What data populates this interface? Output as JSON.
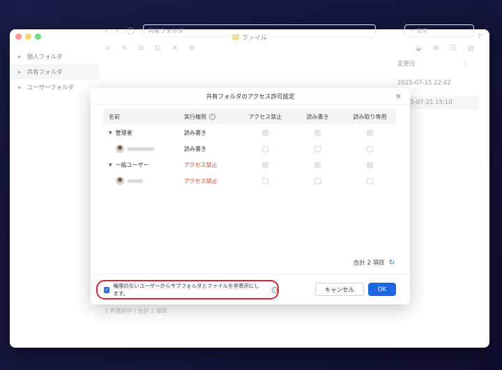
{
  "window": {
    "title": "ファイル",
    "help": "?"
  },
  "sidebar": {
    "items": [
      {
        "label": "個人フォルダ",
        "active": false
      },
      {
        "label": "共有フォルダ",
        "active": true
      },
      {
        "label": "ユーザーフォルダ",
        "active": false
      }
    ]
  },
  "toolbar": {
    "back": "‹",
    "forward": "›",
    "history": "◯",
    "path": "共有フォルダ",
    "search_placeholder": "一 検索"
  },
  "file_list": {
    "date_header": "変更日",
    "dates": [
      "2025-07-15 22:42",
      "2025-07-21 15:10"
    ],
    "status": "1 件選択中 | 合計 2 項目"
  },
  "dialog": {
    "title": "共有フォルダのアクセス許可設定",
    "close": "×",
    "columns": {
      "name": "名前",
      "permission": "実行権限",
      "deny": "アクセス禁止",
      "read_write": "読み書き",
      "read_only": "読み取り専用"
    },
    "rows": [
      {
        "name": "管理者",
        "type": "group",
        "permission": "読み書き",
        "danger": false
      },
      {
        "name": "",
        "type": "user",
        "permission": "読み書き",
        "danger": false
      },
      {
        "name": "一般ユーザー",
        "type": "group",
        "permission": "アクセス禁止",
        "danger": true
      },
      {
        "name": "",
        "type": "user",
        "permission": "アクセス禁止",
        "danger": true
      }
    ],
    "total": "合計 2 項目",
    "hide_option_label": "権限のないユーザーからサブフォルダとファイルを非表示にします。",
    "hide_option_checked": true,
    "cancel_label": "キャンセル",
    "ok_label": "OK"
  },
  "colors": {
    "accent": "#1f66e5",
    "danger": "#e8412c",
    "highlight_frame": "#d9232d"
  }
}
